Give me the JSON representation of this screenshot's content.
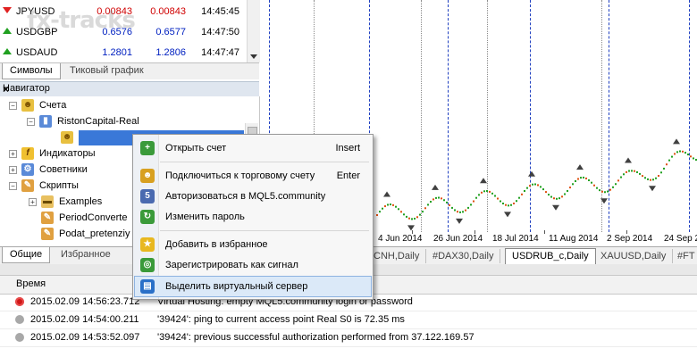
{
  "watermark": "fx-tracks",
  "market_watch": {
    "rows": [
      {
        "symbol": "JPYUSD",
        "bid": "0.00843",
        "ask": "0.00843",
        "time": "14:45:45",
        "dir": "down",
        "color": "red"
      },
      {
        "symbol": "USDGBP",
        "bid": "0.6576",
        "ask": "0.6577",
        "time": "14:47:50",
        "dir": "up",
        "color": "blue"
      },
      {
        "symbol": "USDAUD",
        "bid": "1.2801",
        "ask": "1.2806",
        "time": "14:47:47",
        "dir": "up",
        "color": "blue"
      }
    ],
    "tabs": [
      "Символы",
      "Тиковый график"
    ]
  },
  "navigator": {
    "title": "Навигатор",
    "close": "×",
    "items": [
      {
        "label": "Счета"
      },
      {
        "label": "RistonCapital-Real"
      },
      {
        "label": "Индикаторы"
      },
      {
        "label": "Советники"
      },
      {
        "label": "Скрипты"
      },
      {
        "label": "Examples"
      },
      {
        "label": "PeriodConverte"
      },
      {
        "label": "Podat_pretenziy"
      }
    ],
    "tabs": [
      "Общие",
      "Избранное"
    ]
  },
  "chart": {
    "date_labels": [
      "4 Jun 2014",
      "26 Jun 2014",
      "18 Jul 2014",
      "11 Aug 2014",
      "2 Sep 2014",
      "24 Sep 2"
    ],
    "tabs": [
      "CNH,Daily",
      "#DAX30,Daily",
      "USDRUB_c,Daily",
      "XAUUSD,Daily",
      "#FT"
    ],
    "active_tab": 2
  },
  "context_menu": {
    "items": [
      {
        "label": "Открыть счет",
        "shortcut": "Insert",
        "icon": "open-account-icon",
        "color": "#3a9a3a"
      },
      {
        "label": "Подключиться к торговому счету",
        "shortcut": "Enter",
        "icon": "connect-account-icon",
        "color": "#d8a020"
      },
      {
        "label": "Авторизоваться в MQL5.community",
        "shortcut": "",
        "icon": "mql5-login-icon",
        "color": "#4a6ab0"
      },
      {
        "label": "Изменить пароль",
        "shortcut": "",
        "icon": "change-password-icon",
        "color": "#3a9a3a"
      },
      {
        "label": "Добавить в избранное",
        "shortcut": "",
        "icon": "favorite-star-icon",
        "color": "#e8b820"
      },
      {
        "label": "Зарегистрировать как сигнал",
        "shortcut": "",
        "icon": "signal-icon",
        "color": "#3a9a3a"
      },
      {
        "label": "Выделить виртуальный сервер",
        "shortcut": "",
        "icon": "virtual-server-icon",
        "color": "#2a70c8"
      }
    ]
  },
  "journal": {
    "header": "Время",
    "rows": [
      {
        "time": "2015.02.09 14:56:23.712",
        "message": "Virtual Hosting: empty MQL5.community login or password",
        "level": "error"
      },
      {
        "time": "2015.02.09 14:54:00.211",
        "message": "'39424': ping to current access point Real S0 is 72.35 ms",
        "level": "info"
      },
      {
        "time": "2015.02.09 14:53:52.097",
        "message": "'39424': previous successful authorization performed from 37.122.169.57",
        "level": "info"
      }
    ]
  }
}
